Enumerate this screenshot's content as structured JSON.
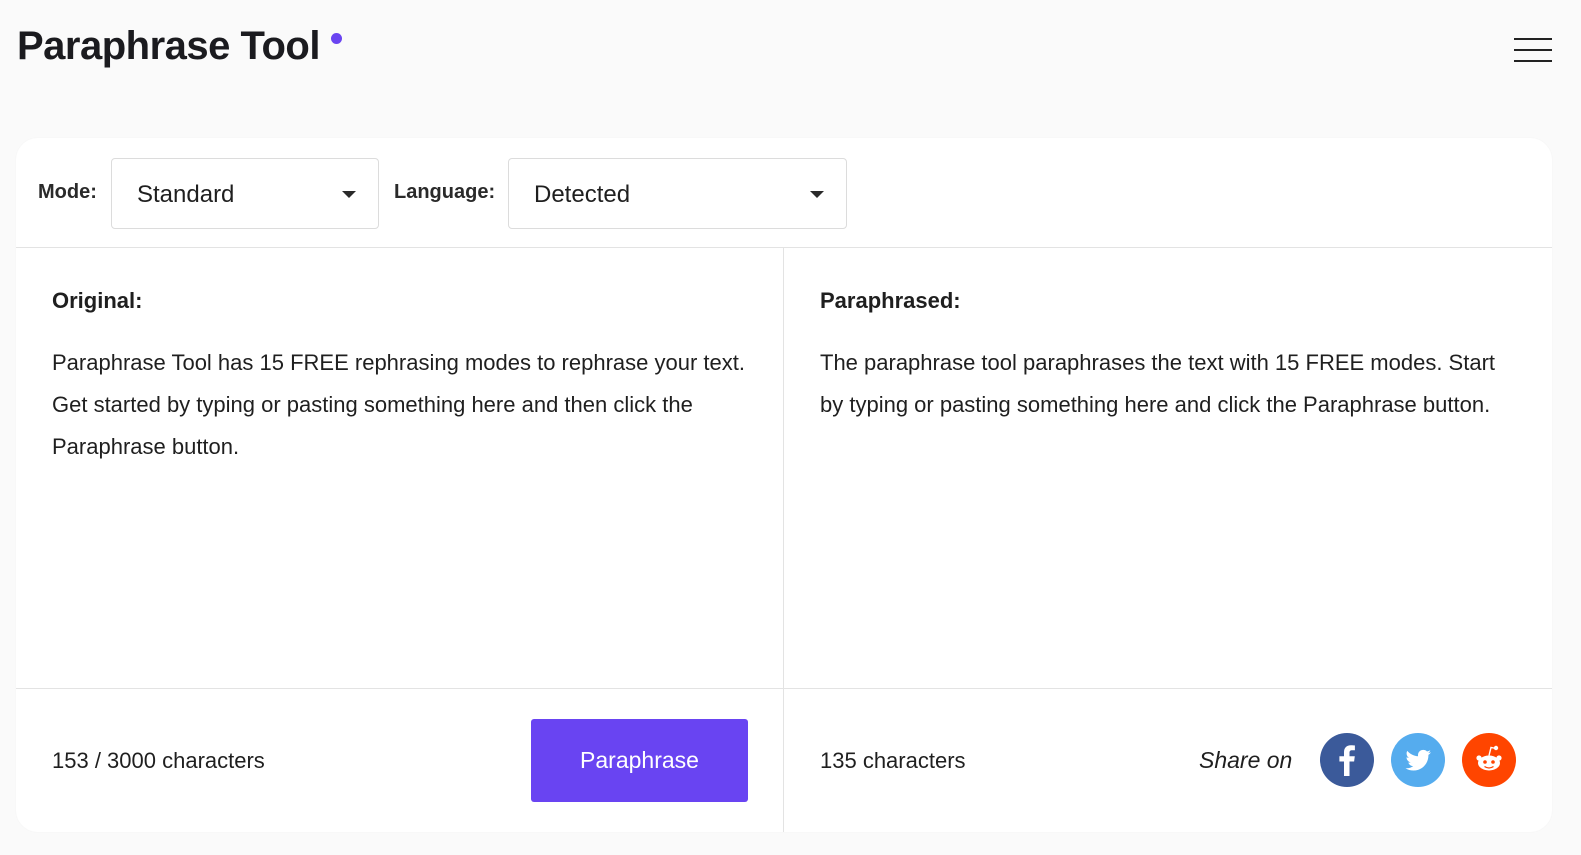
{
  "header": {
    "title": "Paraphrase Tool",
    "accent_color": "#6a44f1",
    "menu_icon": "hamburger-menu-icon"
  },
  "toolbar": {
    "mode_label": "Mode:",
    "mode_value": "Standard",
    "language_label": "Language:",
    "language_value": "Detected"
  },
  "original": {
    "title": "Original:",
    "text": "Paraphrase Tool has 15 FREE rephrasing modes to rephrase your text. Get started by typing or pasting something here and then click the Paraphrase button.",
    "char_count": "153 / 3000 characters",
    "button_label": "Paraphrase",
    "button_color": "#6944f2"
  },
  "paraphrased": {
    "title": "Paraphrased:",
    "text": "The paraphrase tool paraphrases the text with 15 FREE modes. Start by typing or pasting something here and click the Paraphrase button.",
    "char_count": "135 characters",
    "share_label": "Share on",
    "share_icons": [
      {
        "name": "facebook-icon",
        "color": "#3b5a9a"
      },
      {
        "name": "twitter-icon",
        "color": "#55acee"
      },
      {
        "name": "reddit-icon",
        "color": "#ff4500"
      }
    ]
  }
}
